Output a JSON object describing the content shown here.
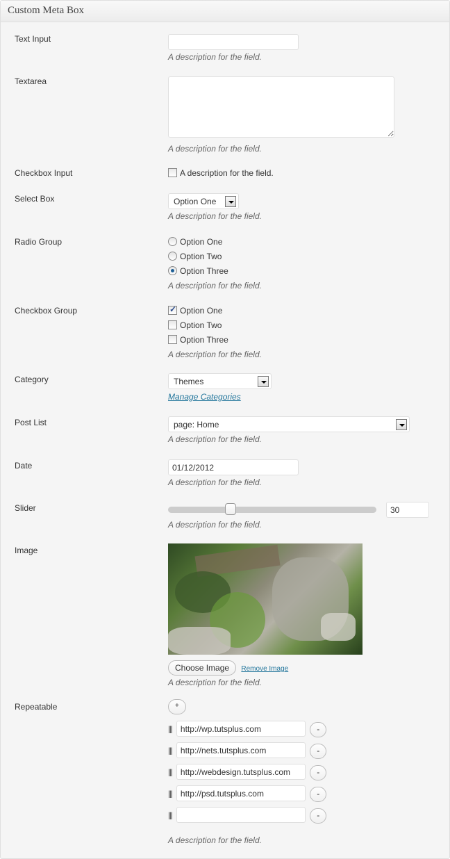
{
  "box": {
    "title": "Custom Meta Box"
  },
  "fields": {
    "text_input": {
      "label": "Text Input",
      "value": "",
      "description": "A description for the field."
    },
    "textarea": {
      "label": "Textarea",
      "value": "",
      "description": "A description for the field."
    },
    "checkbox": {
      "label": "Checkbox Input",
      "checked": false,
      "text": "A description for the field."
    },
    "select": {
      "label": "Select Box",
      "selected": "Option One",
      "description": "A description for the field."
    },
    "radio": {
      "label": "Radio Group",
      "options": [
        {
          "label": "Option One",
          "checked": false
        },
        {
          "label": "Option Two",
          "checked": false
        },
        {
          "label": "Option Three",
          "checked": true
        }
      ],
      "description": "A description for the field."
    },
    "checkbox_group": {
      "label": "Checkbox Group",
      "options": [
        {
          "label": "Option One",
          "checked": true
        },
        {
          "label": "Option Two",
          "checked": false
        },
        {
          "label": "Option Three",
          "checked": false
        }
      ],
      "description": "A description for the field."
    },
    "category": {
      "label": "Category",
      "selected": "Themes",
      "link": "Manage Categories"
    },
    "post_list": {
      "label": "Post List",
      "selected": "page: Home",
      "description": "A description for the field."
    },
    "date": {
      "label": "Date",
      "value": "01/12/2012",
      "description": "A description for the field."
    },
    "slider": {
      "label": "Slider",
      "value": "30",
      "fraction": 0.3,
      "description": "A description for the field."
    },
    "image": {
      "label": "Image",
      "choose_label": "Choose Image",
      "remove_label": "Remove Image",
      "description": "A description for the field."
    },
    "repeatable": {
      "label": "Repeatable",
      "add_label": "+",
      "remove_label": "-",
      "handle": "|||",
      "items": [
        "http://wp.tutsplus.com",
        "http://nets.tutsplus.com",
        "http://webdesign.tutsplus.com",
        "http://psd.tutsplus.com",
        ""
      ],
      "description": "A description for the field."
    }
  }
}
